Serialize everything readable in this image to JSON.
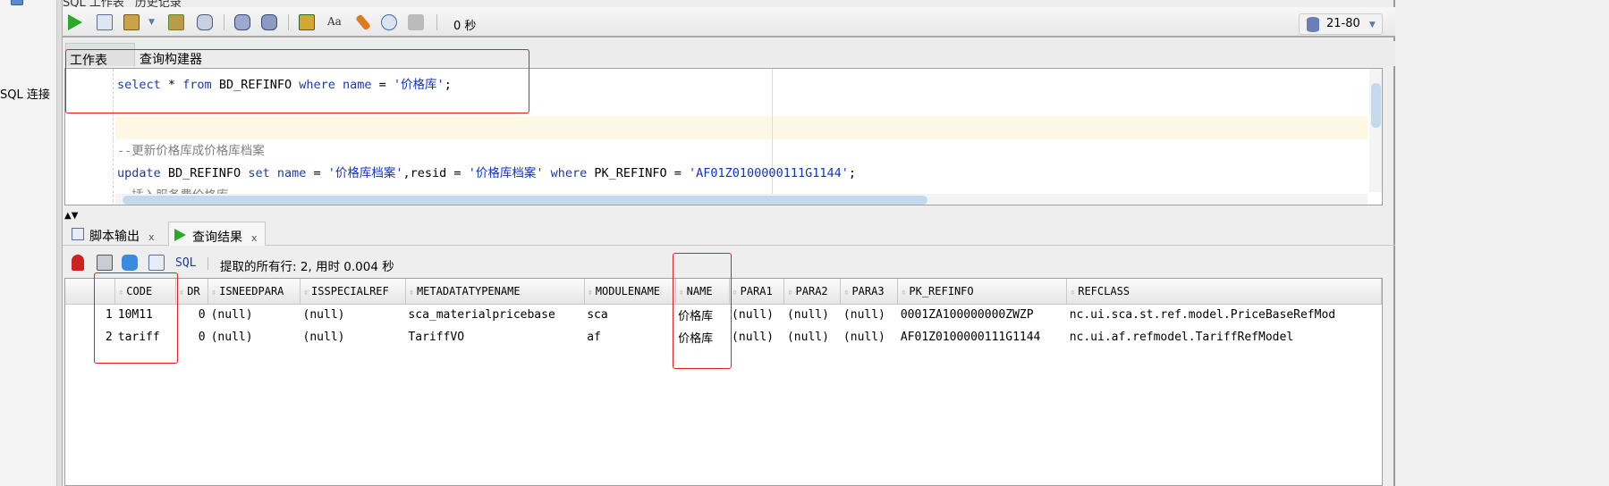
{
  "sidebar": {
    "connection_label": "SQL 连接"
  },
  "top_tabs": [
    "SQL 工作表",
    "历史记录"
  ],
  "toolbar": {
    "icons": [
      "run-statement-icon",
      "run-script-icon",
      "commit-icon",
      "dropdown-arrow-icon",
      "explain-plan-icon",
      "autotrace-icon",
      "commit-transaction-icon",
      "rollback-icon",
      "sql-tuning-icon",
      "to-upper-lower-icon",
      "clear-icon",
      "history-icon",
      "format-icon"
    ],
    "elapsed": "0 秒",
    "connection": "21-80"
  },
  "editor_tabs": [
    {
      "label": "工作表",
      "selected": true
    },
    {
      "label": "查询构建器",
      "selected": false
    }
  ],
  "editor": {
    "lines": [
      [
        {
          "t": "kw",
          "v": "select"
        },
        {
          "t": "id",
          "v": " * "
        },
        {
          "t": "kw",
          "v": "from"
        },
        {
          "t": "id",
          "v": " BD_REFINFO "
        },
        {
          "t": "kw",
          "v": "where"
        },
        {
          "t": "id",
          "v": " "
        },
        {
          "t": "kw",
          "v": "name"
        },
        {
          "t": "id",
          "v": " = "
        },
        {
          "t": "str",
          "v": "'价格库'"
        },
        {
          "t": "id",
          "v": ";"
        }
      ],
      [],
      [],
      [
        {
          "t": "cm",
          "v": "--更新价格库成价格库档案"
        }
      ],
      [
        {
          "t": "kw",
          "v": "update"
        },
        {
          "t": "id",
          "v": " BD_REFINFO "
        },
        {
          "t": "kw",
          "v": "set"
        },
        {
          "t": "id",
          "v": " "
        },
        {
          "t": "kw",
          "v": "name"
        },
        {
          "t": "id",
          "v": " = "
        },
        {
          "t": "str",
          "v": "'价格库档案'"
        },
        {
          "t": "id",
          "v": ",resid = "
        },
        {
          "t": "str",
          "v": "'价格库档案'"
        },
        {
          "t": "id",
          "v": " "
        },
        {
          "t": "kw",
          "v": "where"
        },
        {
          "t": "id",
          "v": " PK_REFINFO = "
        },
        {
          "t": "str",
          "v": "'AF01Z0100000111G1144'"
        },
        {
          "t": "id",
          "v": ";"
        }
      ],
      [
        {
          "t": "cm",
          "v": "--插入服务费价格库"
        }
      ]
    ]
  },
  "result_tabs": [
    {
      "label": "脚本输出",
      "selected": false
    },
    {
      "label": "查询结果",
      "selected": true
    }
  ],
  "result_toolbar": {
    "icons": [
      "pin-icon",
      "print-icon",
      "refresh-icon",
      "delete-icon"
    ],
    "sql_label": "SQL",
    "status": "提取的所有行: 2, 用时 0.004 秒"
  },
  "grid": {
    "columns": [
      "CODE",
      "DR",
      "ISNEEDPARA",
      "ISSPECIALREF",
      "METADATATYPENAME",
      "MODULENAME",
      "NAME",
      "PARA1",
      "PARA2",
      "PARA3",
      "PK_REFINFO",
      "REFCLASS"
    ],
    "rows": [
      [
        "1",
        "10M11",
        "0",
        "(null)",
        "(null)",
        "sca_materialpricebase",
        "sca",
        "价格库",
        "(null)",
        "(null)",
        "(null)",
        "0001ZA100000000ZWZP",
        "nc.ui.sca.st.ref.model.PriceBaseRefMod"
      ],
      [
        "2",
        "tariff",
        "0",
        "(null)",
        "(null)",
        "TariffVO",
        "af",
        "价格库",
        "(null)",
        "(null)",
        "(null)",
        "AF01Z0100000111G1144",
        "nc.ui.af.refmodel.TariffRefModel"
      ]
    ]
  },
  "colors": {
    "annotation": "#e02020",
    "keyword": "#1c3aa9",
    "comment": "#808080",
    "current_line": "#fdf8e4"
  }
}
